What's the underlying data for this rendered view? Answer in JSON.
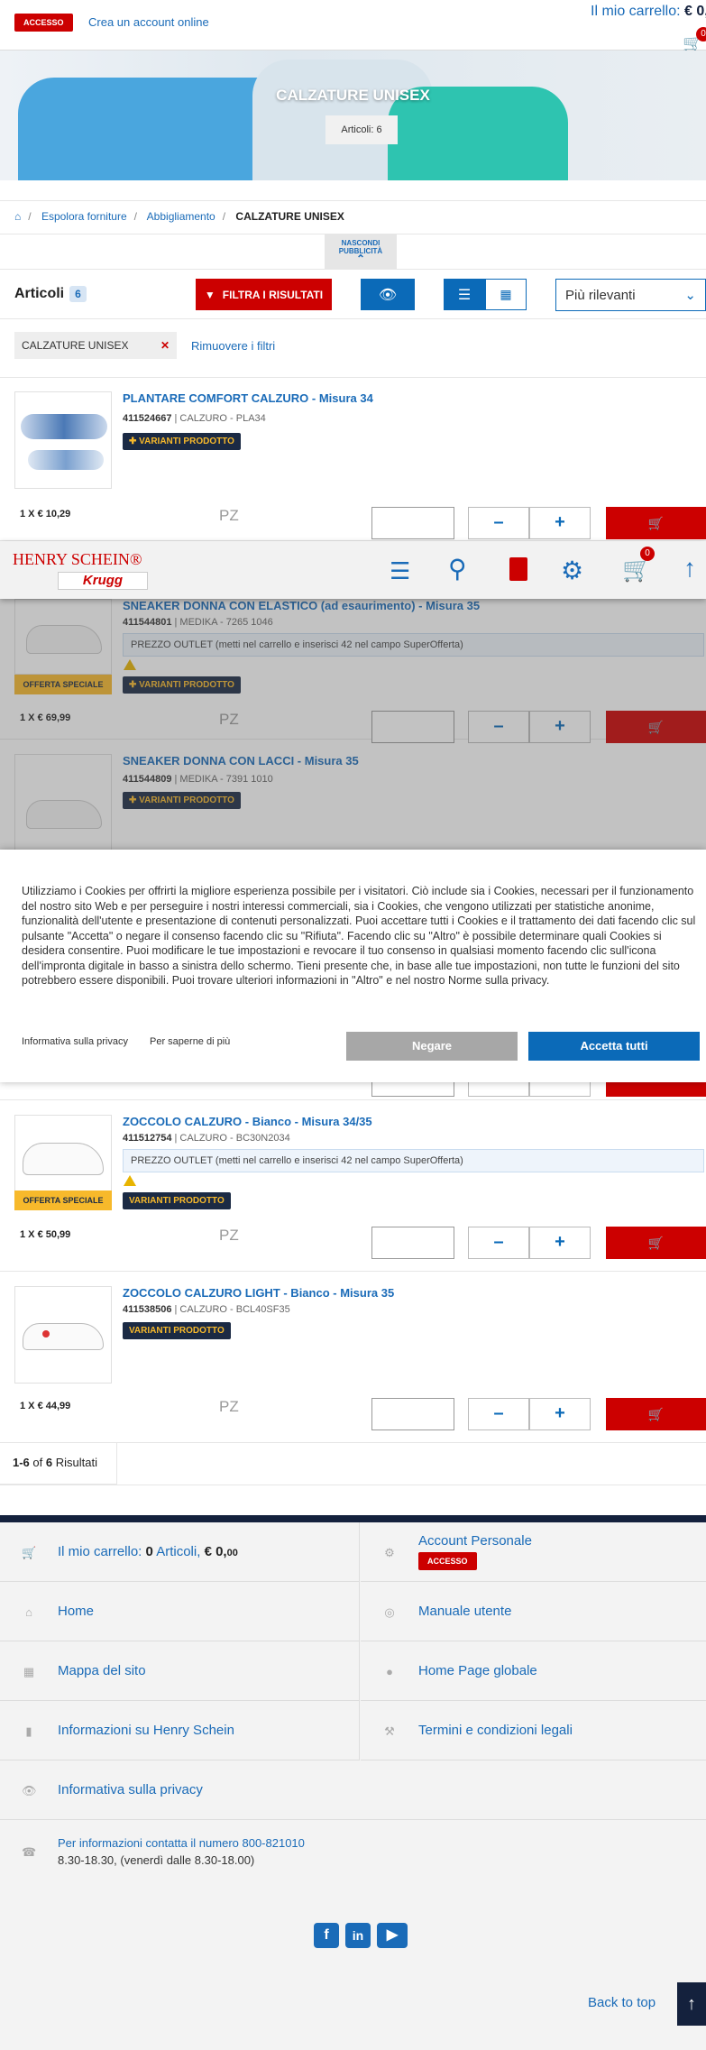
{
  "topbar": {
    "accesso": "ACCESSO",
    "create_account": "Crea un account online",
    "cart_label": "Il mio carrello:",
    "cart_amount": "€ 0,",
    "cart_count": "0"
  },
  "hero": {
    "title": "CALZATURE UNISEX",
    "count": "Articoli: 6"
  },
  "breadcrumb": {
    "item1": "Espolora forniture",
    "item2": "Abbigliamento",
    "current": "CALZATURE UNISEX"
  },
  "ads_toggle": {
    "line1": "NASCONDI",
    "line2": "PUBBLICITÀ"
  },
  "toolbar": {
    "label": "Articoli",
    "count": "6",
    "filter": "FILTRA I RISULTATI",
    "sort": "Più rilevanti"
  },
  "active_filter": {
    "chip": "CALZATURE UNISEX",
    "remove": "Rimuovere i filtri"
  },
  "products": [
    {
      "title": "PLANTARE COMFORT CALZURO - Misura 34",
      "code": "411524667",
      "brand": "| CALZURO - PLA34",
      "variants": "VARIANTI PRODOTTO",
      "price": "1 X € 10,29",
      "unit": "PZ"
    },
    {
      "title": "SNEAKER DONNA CON ELASTICO (ad esaurimento) - Misura 35",
      "code": "411544801",
      "brand": "| MEDIKA - 7265 1046",
      "outlet": "PREZZO OUTLET (metti nel carrello e inserisci 42 nel campo SuperOfferta)",
      "offer": "OFFERTA SPECIALE",
      "variants": "VARIANTI PRODOTTO",
      "price": "1 X € 69,99",
      "unit": "PZ"
    },
    {
      "title": "SNEAKER DONNA CON LACCI - Misura 35",
      "code": "411544809",
      "brand": "| MEDIKA - 7391 1010",
      "variants": "VARIANTI PRODOTTO"
    },
    {
      "title": "ZOCCOLO CALZURO - Bianco - Misura 34/35",
      "code": "411512754",
      "brand": "| CALZURO - BC30N2034",
      "outlet": "PREZZO OUTLET (metti nel carrello e inserisci 42 nel campo SuperOfferta)",
      "offer": "OFFERTA SPECIALE",
      "variants": "VARIANTI PRODOTTO",
      "price": "1 X € 50,99",
      "unit": "PZ"
    },
    {
      "title": "ZOCCOLO CALZURO LIGHT - Bianco - Misura 35",
      "code": "411538506",
      "brand": "| CALZURO - BCL40SF35",
      "variants": "VARIANTI PRODOTTO",
      "price": "1 X € 44,99",
      "unit": "PZ"
    }
  ],
  "sticky": {
    "brand1": "HENRY SCHEIN®",
    "brand2": "Krugg",
    "cart_count": "0"
  },
  "cookie": {
    "text": "Utilizziamo i Cookies per offrirti la migliore esperienza possibile per i visitatori. Ciò include sia i Cookies, necessari per il funzionamento del nostro sito Web e per perseguire i nostri interessi commerciali, sia i Cookies, che vengono utilizzati per statistiche anonime, funzionalità dell'utente e presentazione di contenuti personalizzati. Puoi accettare tutti i Cookies e il trattamento dei dati facendo clic sul pulsante \"Accetta\" o negare il consenso facendo clic su \"Rifiuta\". Facendo clic su \"Altro\" è possibile determinare quali Cookies si desidera consentire. Puoi modificare le tue impostazioni e revocare il tuo consenso in qualsiasi momento facendo clic sull'icona dell'impronta digitale in basso a sinistra dello schermo. Tieni presente che, in base alle tue impostazioni, non tutte le funzioni del sito potrebbero essere disponibili. Puoi trovare ulteriori informazioni in \"Altro\" e nel nostro Norme sulla privacy.",
    "privacy": "Informativa sulla privacy",
    "more": "Per saperne di più",
    "deny": "Negare",
    "accept": "Accetta tutti"
  },
  "results": {
    "range": "1-6",
    "of": "of",
    "total": "6",
    "label": "Risultati"
  },
  "footer": {
    "cart_label": "Il mio carrello:",
    "cart_count": "0",
    "cart_items": "Articoli,",
    "cart_amount": "€ 0,",
    "cart_cents": "00",
    "account": "Account Personale",
    "accesso": "ACCESSO",
    "home": "Home",
    "manual": "Manuale utente",
    "sitemap": "Mappa del sito",
    "global": "Home Page globale",
    "info": "Informazioni su Henry Schein",
    "terms": "Termini e condizioni legali",
    "privacy": "Informativa sulla privacy",
    "contact": "Per informazioni contatta il numero 800-821010",
    "hours": "8.30-18.30, (venerdì dalle 8.30-18.00)",
    "back_top": "Back to top"
  }
}
